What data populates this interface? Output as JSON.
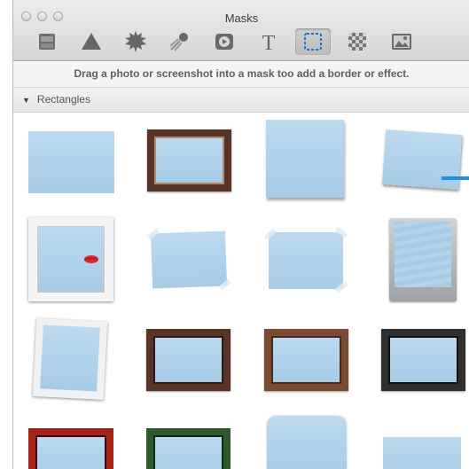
{
  "window": {
    "title": "Masks"
  },
  "toolbar": {
    "tools": [
      {
        "name": "shadow-tool",
        "icon": "layered-rectangle-icon"
      },
      {
        "name": "shape-tool",
        "icon": "triangle-icon"
      },
      {
        "name": "badge-tool",
        "icon": "starburst-icon"
      },
      {
        "name": "effect-tool",
        "icon": "comet-icon"
      },
      {
        "name": "media-tool",
        "icon": "play-button-icon"
      },
      {
        "name": "text-tool",
        "icon": "text-T-icon"
      },
      {
        "name": "mask-tool",
        "icon": "dashed-rectangle-icon",
        "active": true
      },
      {
        "name": "texture-tool",
        "icon": "checkerboard-icon"
      },
      {
        "name": "image-tool",
        "icon": "picture-icon"
      }
    ]
  },
  "hint": {
    "text": "Drag a photo or screenshot into a mask too add a border or effect."
  },
  "section": {
    "label": "Rectangles",
    "expanded": true
  },
  "masks": [
    {
      "style": "plain"
    },
    {
      "style": "wood-frame-dark"
    },
    {
      "style": "paper-shadow"
    },
    {
      "style": "tilted-paper"
    },
    {
      "style": "white-frame-lipstick"
    },
    {
      "style": "taped-tilt"
    },
    {
      "style": "taped-straight"
    },
    {
      "style": "metal-wave"
    },
    {
      "style": "white-frame-tilt"
    },
    {
      "style": "wood-frame-brown"
    },
    {
      "style": "wood-frame-light"
    },
    {
      "style": "black-frame"
    },
    {
      "style": "red-frame"
    },
    {
      "style": "green-frame"
    },
    {
      "style": "rounded-card"
    },
    {
      "style": "plain-bottom"
    }
  ],
  "colors": {
    "accent": "#1c8fe0",
    "mask_fill": "#a9cde8"
  }
}
